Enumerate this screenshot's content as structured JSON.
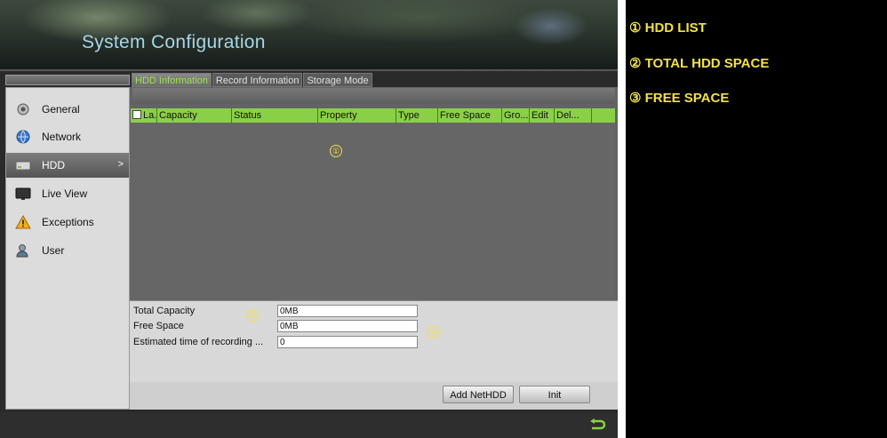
{
  "header": {
    "title": "System Configuration"
  },
  "tabs": [
    {
      "label": "HDD Information",
      "active": true
    },
    {
      "label": "Record Information",
      "active": false
    },
    {
      "label": "Storage Mode",
      "active": false
    }
  ],
  "sidebar": {
    "items": [
      {
        "label": "General",
        "icon": "camera-settings-icon",
        "active": false
      },
      {
        "label": "Network",
        "icon": "globe-icon",
        "active": false
      },
      {
        "label": "HDD",
        "icon": "hdd-icon",
        "active": true,
        "arrow": ">"
      },
      {
        "label": "Live View",
        "icon": "monitor-icon",
        "active": false
      },
      {
        "label": "Exceptions",
        "icon": "warning-icon",
        "active": false
      },
      {
        "label": "User",
        "icon": "user-icon",
        "active": false
      }
    ]
  },
  "hdd_table": {
    "columns": [
      "La...",
      "Capacity",
      "Status",
      "Property",
      "Type",
      "Free Space",
      "Gro...",
      "Edit",
      "Del..."
    ],
    "rows": []
  },
  "summary": {
    "total_capacity_label": "Total Capacity",
    "total_capacity_value": "0MB",
    "free_space_label": "Free Space",
    "free_space_value": "0MB",
    "estimated_label": "Estimated time of recording ...",
    "estimated_value": "0"
  },
  "buttons": {
    "add_nethdd": "Add NetHDD",
    "init": "Init"
  },
  "markers": {
    "one": "①",
    "two": "②",
    "three": "③"
  },
  "legend": {
    "item1": "① HDD LIST",
    "item2": "② TOTAL HDD SPACE",
    "item3": "③ FREE SPACE"
  },
  "colors": {
    "accent_green": "#8ad046",
    "active_tab_text": "#9ee04a",
    "marker_yellow": "#f2e04a",
    "title_blue": "#a6d6e6"
  }
}
